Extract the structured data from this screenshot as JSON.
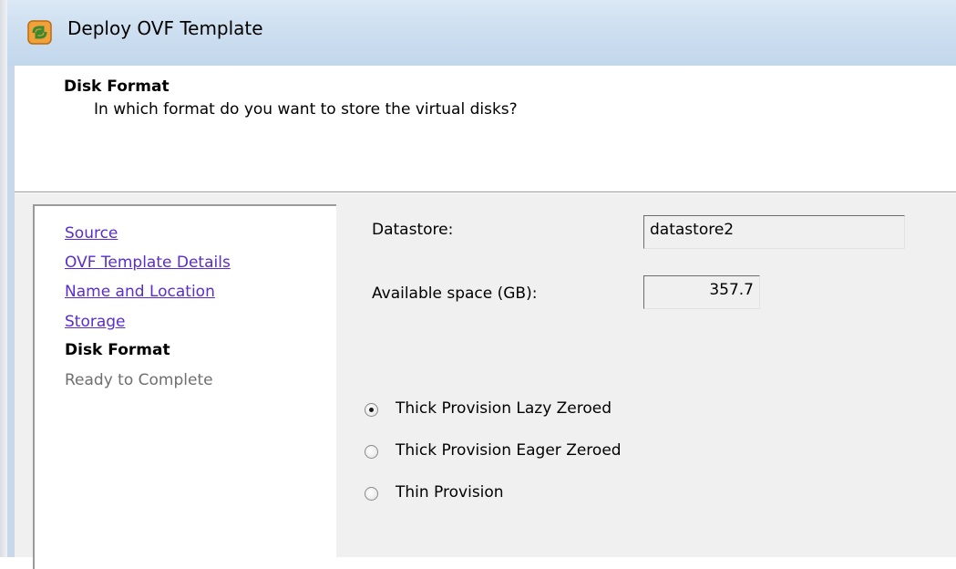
{
  "window": {
    "title": "Deploy OVF Template",
    "icon": "vsphere-app-icon"
  },
  "header": {
    "title": "Disk Format",
    "subtitle": "In which format do you want to store the virtual disks?"
  },
  "nav": {
    "items": [
      {
        "label": "Source",
        "state": "link"
      },
      {
        "label": "OVF Template Details",
        "state": "link"
      },
      {
        "label": "Name and Location",
        "state": "link"
      },
      {
        "label": "Storage",
        "state": "link"
      },
      {
        "label": "Disk Format",
        "state": "current"
      },
      {
        "label": "Ready to Complete",
        "state": "disabled"
      }
    ]
  },
  "form": {
    "datastore_label": "Datastore:",
    "datastore_value": "datastore2",
    "available_label": "Available space (GB):",
    "available_value": "357.7",
    "options": [
      {
        "label": "Thick Provision Lazy Zeroed",
        "checked": true
      },
      {
        "label": "Thick Provision Eager Zeroed",
        "checked": false
      },
      {
        "label": "Thin Provision",
        "checked": false
      }
    ]
  }
}
